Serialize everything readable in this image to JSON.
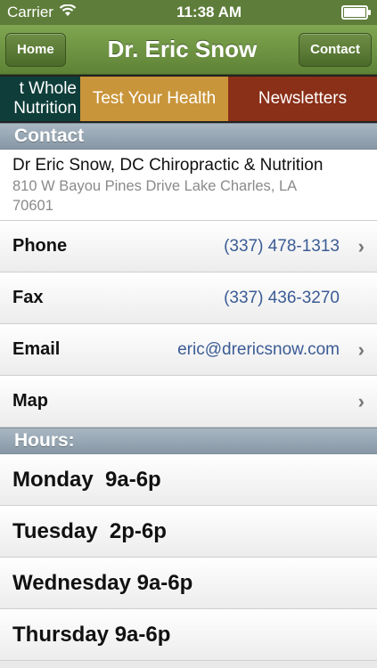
{
  "status_bar": {
    "carrier": "Carrier",
    "time": "11:38 AM"
  },
  "nav": {
    "left_button": "Home",
    "title": "Dr. Eric Snow",
    "right_button": "Contact"
  },
  "tabs": [
    {
      "label_line1": "t Whole",
      "label_line2": "Nutrition"
    },
    {
      "label": "Test Your Health"
    },
    {
      "label": "Newsletters"
    }
  ],
  "contact": {
    "header": "Contact",
    "practice_name": "Dr Eric Snow, DC Chiropractic & Nutrition",
    "address_line1": "810 W Bayou Pines Drive Lake Charles, LA",
    "address_line2": "70601",
    "rows": [
      {
        "label": "Phone",
        "value": "(337) 478-1313",
        "chevron": true
      },
      {
        "label": "Fax",
        "value": "(337) 436-3270",
        "chevron": false
      },
      {
        "label": "Email",
        "value": "eric@drericsnow.com",
        "chevron": true
      },
      {
        "label": "Map",
        "value": "",
        "chevron": true
      }
    ]
  },
  "hours": {
    "header": "Hours:",
    "rows": [
      "Monday  9a-6p",
      "Tuesday  2p-6p",
      "Wednesday 9a-6p",
      "Thursday 9a-6p"
    ]
  },
  "icons": {
    "wifi": "wifi-icon",
    "battery": "battery-icon",
    "chevron": "chevron-right-icon"
  }
}
